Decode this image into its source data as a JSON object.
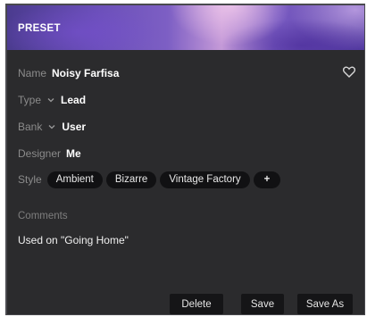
{
  "header": {
    "title": "PRESET"
  },
  "fields": {
    "name": {
      "label": "Name",
      "value": "Noisy Farfisa"
    },
    "type": {
      "label": "Type",
      "value": "Lead"
    },
    "bank": {
      "label": "Bank",
      "value": "User"
    },
    "designer": {
      "label": "Designer",
      "value": "Me"
    },
    "style": {
      "label": "Style",
      "tags": [
        "Ambient",
        "Bizarre",
        "Vintage Factory"
      ],
      "add_label": "+"
    }
  },
  "comments": {
    "label": "Comments",
    "value": "Used on \"Going Home\""
  },
  "buttons": {
    "delete": "Delete",
    "save": "Save",
    "save_as": "Save As"
  },
  "icons": {
    "favorite": "heart-icon",
    "dropdown": "chevron-down-icon"
  },
  "colors": {
    "panel_bg": "#2b2b2d",
    "tag_bg": "#111113",
    "label_text": "#8b8b8b",
    "value_text": "#ffffff"
  }
}
